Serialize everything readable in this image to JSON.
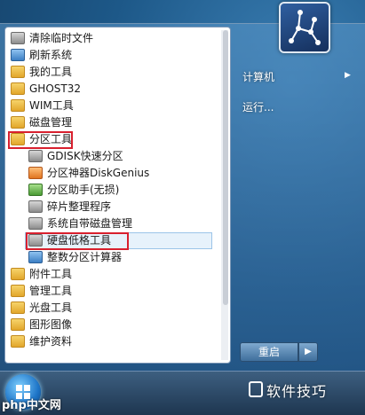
{
  "menu": {
    "items": [
      {
        "label": "清除临时文件",
        "kind": "app",
        "tone": "gray"
      },
      {
        "label": "刷新系统",
        "kind": "app",
        "tone": "blue"
      },
      {
        "label": "我的工具",
        "kind": "folder"
      },
      {
        "label": "GHOST32",
        "kind": "folder"
      },
      {
        "label": "WIM工具",
        "kind": "folder"
      },
      {
        "label": "磁盘管理",
        "kind": "folder"
      },
      {
        "label": "分区工具",
        "kind": "folder",
        "highlight": true
      },
      {
        "label": "GDISK快速分区",
        "kind": "app",
        "tone": "gray",
        "indent": true
      },
      {
        "label": "分区神器DiskGenius",
        "kind": "app",
        "tone": "orange",
        "indent": true
      },
      {
        "label": "分区助手(无损)",
        "kind": "app",
        "tone": "green",
        "indent": true
      },
      {
        "label": "碎片整理程序",
        "kind": "app",
        "tone": "gray",
        "indent": true
      },
      {
        "label": "系统自带磁盘管理",
        "kind": "app",
        "tone": "gray",
        "indent": true
      },
      {
        "label": "硬盘低格工具",
        "kind": "app",
        "tone": "gray",
        "indent": true,
        "highlight": true,
        "selected": true
      },
      {
        "label": "整数分区计算器",
        "kind": "app",
        "tone": "blue",
        "indent": true
      },
      {
        "label": "附件工具",
        "kind": "folder"
      },
      {
        "label": "管理工具",
        "kind": "folder"
      },
      {
        "label": "光盘工具",
        "kind": "folder"
      },
      {
        "label": "图形图像",
        "kind": "folder"
      },
      {
        "label": "维护资料",
        "kind": "folder"
      }
    ]
  },
  "right": {
    "computer_label": "计算机",
    "run_label": "运行...",
    "restart_label": "重启"
  },
  "watermark": {
    "left_text": "php中文网",
    "right_text": "软件技巧"
  },
  "colors": {
    "highlight_border": "#d8202e",
    "selection_bg": "#e7f2fb"
  }
}
